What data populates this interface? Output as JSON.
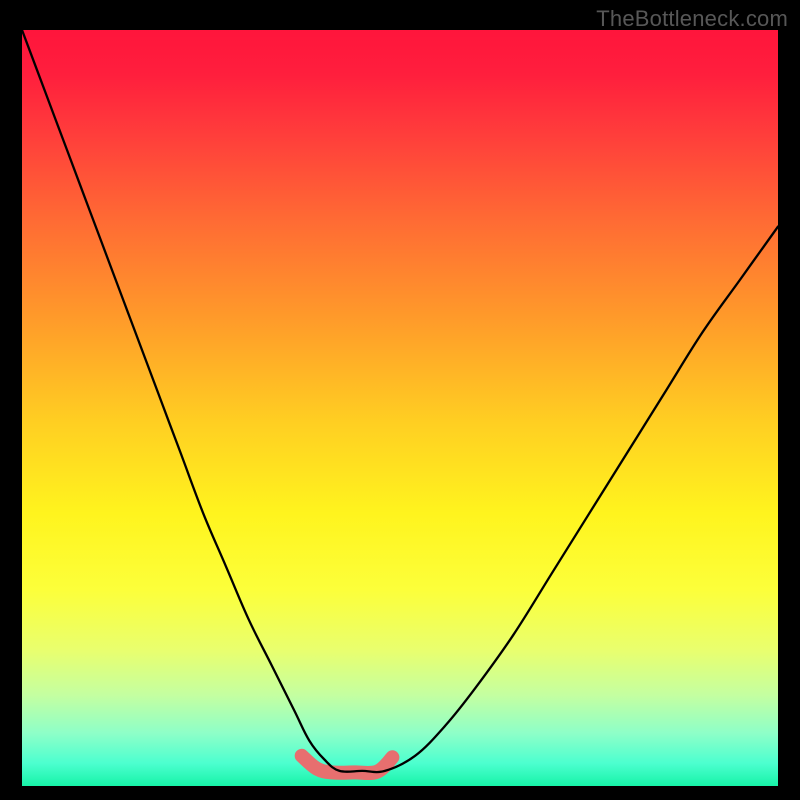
{
  "watermark": "TheBottleneck.com",
  "colors": {
    "frame_bg": "#000000",
    "watermark": "#575757",
    "curve_stroke": "#000000",
    "sweet_spot_stroke": "#e76f6f",
    "gradient_top": "#ff153c",
    "gradient_bottom": "#17f3a8"
  },
  "chart_data": {
    "type": "line",
    "title": "",
    "xlabel": "",
    "ylabel": "",
    "xlim": [
      0,
      100
    ],
    "ylim": [
      0,
      100
    ],
    "grid": false,
    "series": [
      {
        "name": "bottleneck-curve",
        "x": [
          0,
          3,
          6,
          9,
          12,
          15,
          18,
          21,
          24,
          27,
          30,
          33,
          36,
          38,
          40,
          42,
          45,
          48,
          52,
          56,
          60,
          65,
          70,
          75,
          80,
          85,
          90,
          95,
          100
        ],
        "y": [
          100,
          92,
          84,
          76,
          68,
          60,
          52,
          44,
          36,
          29,
          22,
          16,
          10,
          6,
          3.5,
          2,
          2,
          2,
          4,
          8,
          13,
          20,
          28,
          36,
          44,
          52,
          60,
          67,
          74
        ]
      },
      {
        "name": "sweet-spot-band",
        "x": [
          37,
          39,
          41,
          44,
          47,
          49
        ],
        "y": [
          4,
          2.3,
          1.8,
          1.8,
          1.9,
          3.8
        ]
      }
    ],
    "annotations": []
  }
}
